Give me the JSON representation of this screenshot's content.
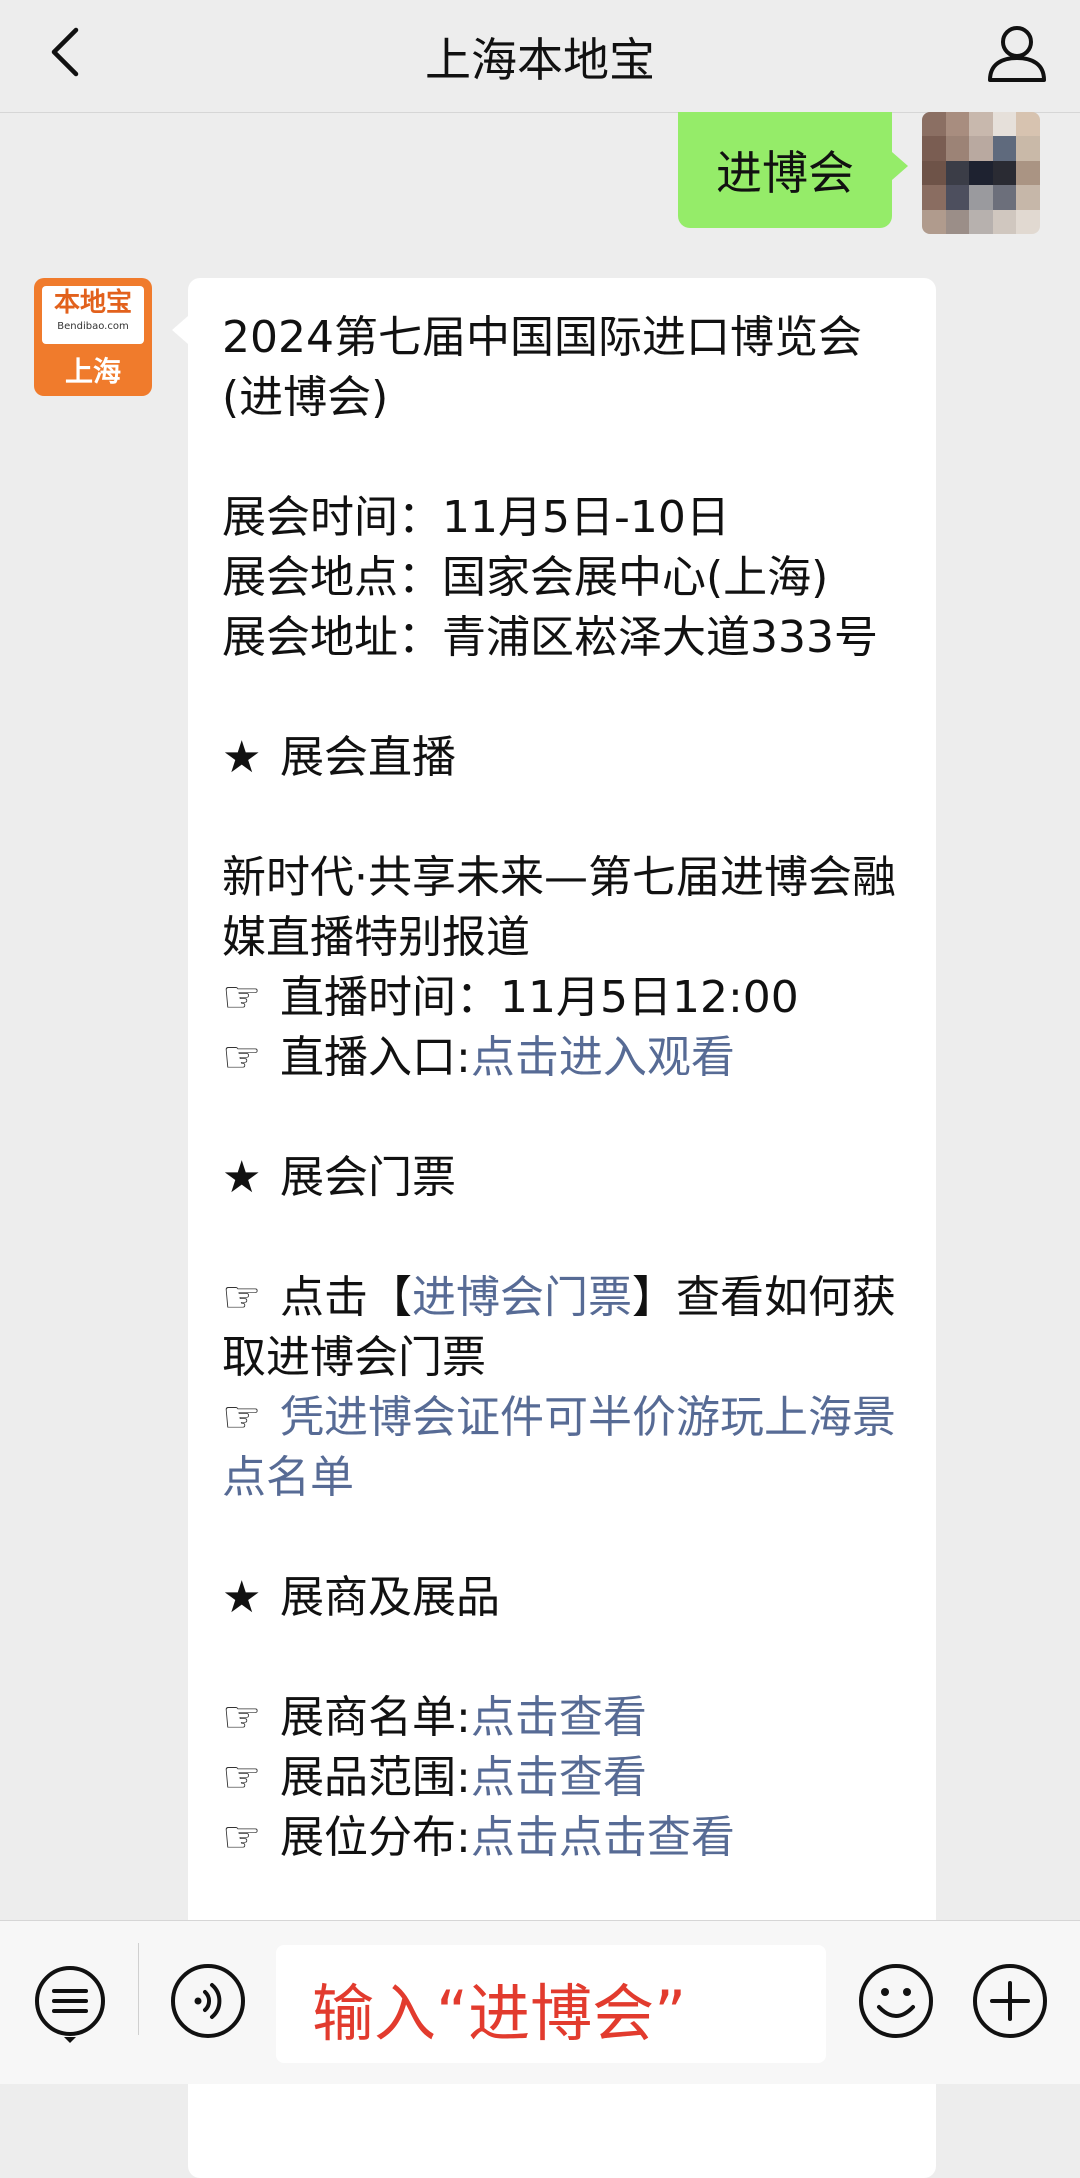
{
  "header": {
    "title": "上海本地宝",
    "back_icon": "chevron-left-icon",
    "profile_icon": "user-icon"
  },
  "chat": {
    "my_message": "进博会",
    "bot_avatar": {
      "logo": "本地宝",
      "domain": "Bendibao.com",
      "city": "上海"
    },
    "reply": {
      "title": "2024第七届中国国际进口博览会(进博会)",
      "time_label": "展会时间：",
      "time_value": "11月5日-10日",
      "venue_label": "展会地点：",
      "venue_value": "国家会展中心(上海)",
      "address_label": "展会地址：",
      "address_value": "青浦区崧泽大道333号",
      "live_heading": "展会直播",
      "live_desc": "新时代·共享未来—第七届进博会融媒直播特别报道",
      "live_time_label": "直播时间：",
      "live_time_value": "11月5日12:00",
      "live_entry_label": "直播入口:",
      "live_entry_link": "点击进入观看",
      "ticket_heading": "展会门票",
      "ticket_click": "点击【",
      "ticket_link": "进博会门票",
      "ticket_rest": "】查看如何获取进博会门票",
      "half_price_link": "凭进博会证件可半价游玩上海景点名单",
      "exhibitor_heading": "展商及展品",
      "exhibitor_list_label": "展商名单:",
      "exhibitor_list_link": "点击查看",
      "product_range_label": "展品范围:",
      "product_range_link": "点击查看",
      "booth_label": "展位分布:",
      "booth_link": "点击点击查看",
      "star_glyph": "★",
      "hand_glyph": "☞"
    }
  },
  "input_bar": {
    "menu_icon": "menu-list-icon",
    "voice_icon": "voice-icon",
    "input_text": "输入“进博会”",
    "emoji_icon": "emoji-icon",
    "plus_icon": "plus-icon"
  },
  "colors": {
    "background": "#ededed",
    "my_bubble": "#95ec69",
    "link": "#576b95",
    "input_hint": "#e23b2e",
    "brand_orange": "#f07b2c"
  }
}
